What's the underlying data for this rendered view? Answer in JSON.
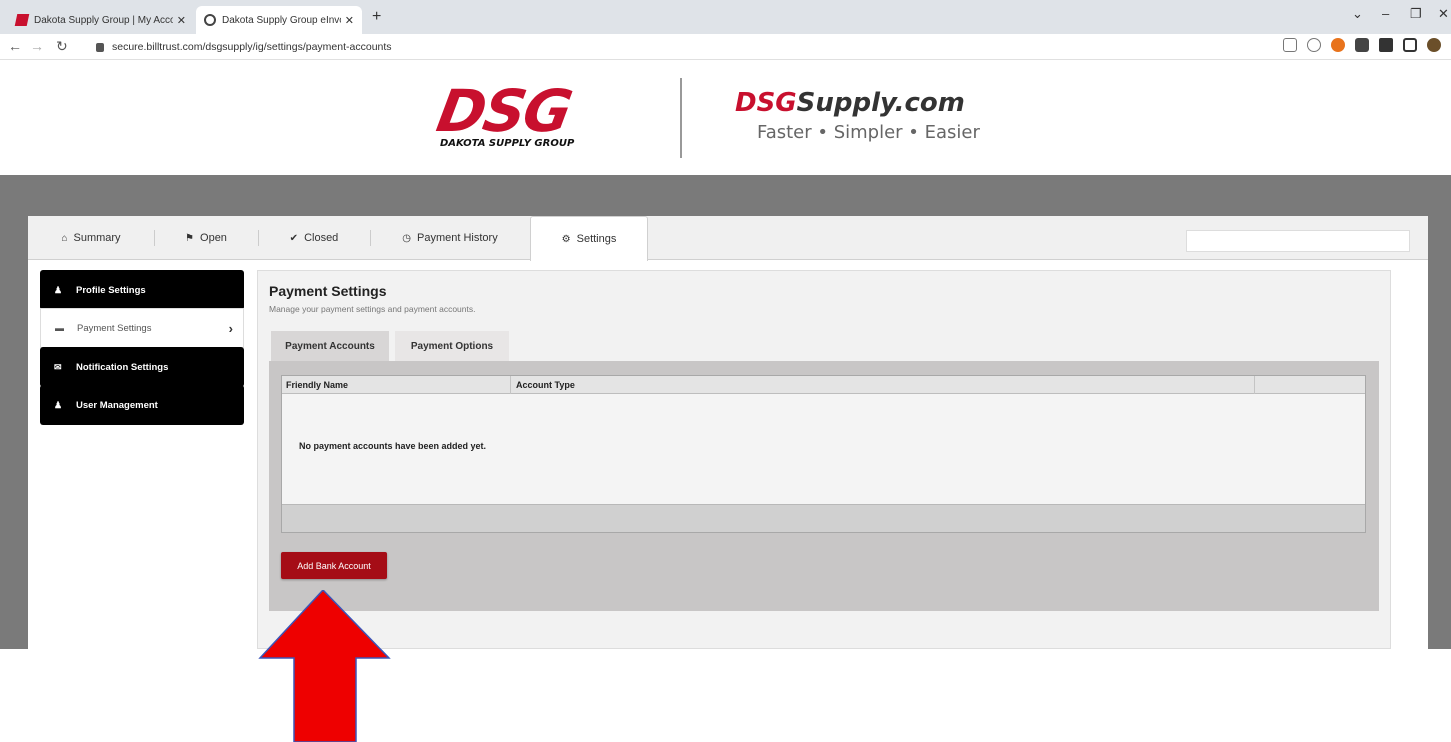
{
  "browser": {
    "tabs": [
      {
        "title": "Dakota Supply Group | My Acco",
        "icon": "dsg-favicon"
      },
      {
        "title": "Dakota Supply Group eInvoice C",
        "icon": "globe-icon"
      }
    ],
    "url": "secure.billtrust.com/dsgsupply/ig/settings/payment-accounts"
  },
  "header": {
    "logo_big": "DSG",
    "logo_small": "DAKOTA SUPPLY GROUP",
    "site_name_red": "DSG",
    "site_name_rest": "Supply.com",
    "tagline": "Faster • Simpler • Easier"
  },
  "nav": {
    "tabs": [
      {
        "label": "Summary",
        "icon": "home-icon"
      },
      {
        "label": "Open",
        "icon": "flag-icon"
      },
      {
        "label": "Closed",
        "icon": "check-icon"
      },
      {
        "label": "Payment History",
        "icon": "clock-icon"
      },
      {
        "label": "Settings",
        "icon": "gear-icon"
      }
    ],
    "active": "Settings"
  },
  "sidebar": {
    "items": [
      {
        "label": "Profile Settings",
        "icon": "user-icon"
      },
      {
        "label": "Payment Settings",
        "icon": "card-icon"
      },
      {
        "label": "Notification Settings",
        "icon": "envelope-icon"
      },
      {
        "label": "User Management",
        "icon": "user-icon"
      }
    ],
    "active": "Payment Settings"
  },
  "main": {
    "title": "Payment Settings",
    "subtitle": "Manage your payment settings and payment accounts.",
    "subtabs": [
      "Payment Accounts",
      "Payment Options"
    ],
    "active_subtab": "Payment Accounts",
    "table": {
      "columns": [
        "Friendly Name",
        "Account Type",
        ""
      ],
      "empty_message": "No payment accounts have been added yet."
    },
    "add_button": "Add Bank Account"
  },
  "colors": {
    "brand_red": "#c8102e",
    "button_red": "#a50d16",
    "annotation_arrow": "#ee0000"
  }
}
